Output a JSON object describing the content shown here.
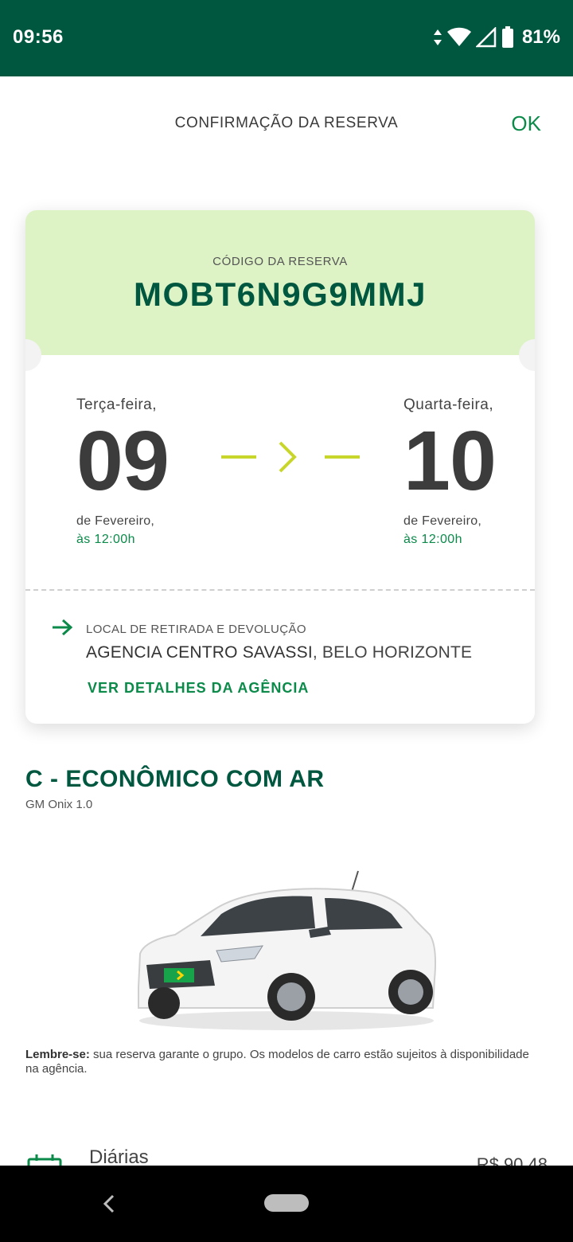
{
  "status_bar": {
    "time": "09:56",
    "battery": "81%",
    "icons": [
      "data-arrows-icon",
      "wifi-icon",
      "signal-icon",
      "battery-icon"
    ]
  },
  "header": {
    "title": "CONFIRMAÇÃO DA RESERVA",
    "ok_label": "OK"
  },
  "reservation": {
    "code_label": "CÓDIGO DA RESERVA",
    "code": "MOBT6N9G9MMJ",
    "pickup": {
      "weekday": "Terça-feira,",
      "day": "09",
      "month": "de Fevereiro,",
      "time": "às 12:00h"
    },
    "return": {
      "weekday": "Quarta-feira,",
      "day": "10",
      "month": "de Fevereiro,",
      "time": "às 12:00h"
    },
    "location_label": "LOCAL DE RETIRADA E DEVOLUÇÃO",
    "location_name": "AGENCIA CENTRO SAVASSI",
    "location_city": ", BELO HORIZONTE",
    "details_link": "VER DETALHES DA AGÊNCIA"
  },
  "car": {
    "group": "C - ECONÔMICO COM AR",
    "model": "GM Onix 1.0",
    "reminder_bold": "Lembre-se:",
    "reminder_text": " sua reserva garante o grupo. Os modelos de carro estão sujeitos à disponibilidade na agência."
  },
  "pricing": {
    "label": "Diárias",
    "value": "R$ 90,48"
  },
  "colors": {
    "brand_dark": "#00573f",
    "brand_green": "#0b8a4a",
    "code_bg": "#ddf3c6",
    "accent_lime": "#c8d62b"
  }
}
